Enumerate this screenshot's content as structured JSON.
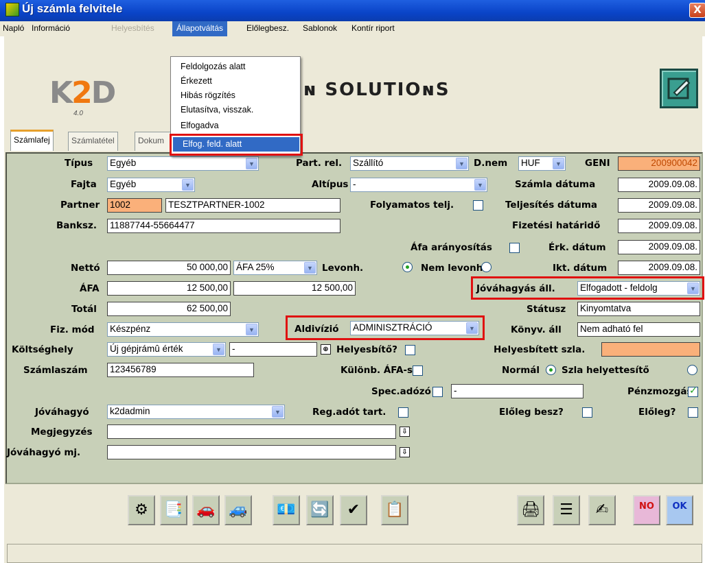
{
  "window": {
    "title": "Új számla felvitele",
    "close_label": "X"
  },
  "menu": [
    "Napló",
    "Információ",
    "Helyesbítés",
    "Állapotváltás",
    "Előlegbesz.",
    "Sablonok",
    "Kontír riport"
  ],
  "dropdown": [
    "Feldolgozás alatt",
    "Érkezett",
    "Hibás rögzítés",
    "Elutasítva, visszak.",
    "Elfogadva",
    "Elfog. feld. alatt"
  ],
  "logo": {
    "k": "K",
    "two": "2",
    "d": "D",
    "version": "4.0",
    "solutions": "ɴ SOLUTIOɴS"
  },
  "tabs": [
    "Számlafej",
    "Számlatétel",
    "Dokum"
  ],
  "labels": {
    "tipus": "Típus",
    "part_rel": "Part. rel.",
    "dnem": "D.nem",
    "geni": "GENI",
    "fajta": "Fajta",
    "altipus": "Altípus",
    "szamla_datuma": "Számla dátuma",
    "partner": "Partner",
    "folyamatos": "Folyamatos telj.",
    "teljesites": "Teljesítés dátuma",
    "banksz": "Banksz.",
    "fizetesi": "Fizetési határidő",
    "afa_aranyositas": "Áfa arányosítás",
    "erk_datum": "Érk. dátum",
    "netto": "Nettó",
    "levonh": "Levonh.",
    "nem_levonh": "Nem levonh.",
    "ikt_datum": "Ikt. dátum",
    "afa": "ÁFA",
    "jovahagyas_all": "Jóváhagyás áll.",
    "total": "Totál",
    "statusz": "Státusz",
    "fiz_mod": "Fiz. mód",
    "aldivizio": "Aldivízió",
    "konyv_all": "Könyv. áll",
    "koltseghely": "Költséghely",
    "helyesbito": "Helyesbítő?",
    "helyesbitett": "Helyesbített szla.",
    "szamlaszam": "Számlaszám",
    "kulonb_afa": "Különb. ÁFA-s",
    "normal": "Normál",
    "szla_helyettesito": "Szla helyettesítő",
    "spec_adozo": "Spec.adózó",
    "penzmozgas": "Pénzmozgás",
    "jovahagyo": "Jóváhagyó",
    "reg_adot": "Reg.adót tart.",
    "eloleg_besz": "Előleg besz?",
    "eloleg": "Előleg?",
    "megjegyzes": "Megjegyzés",
    "jovahagyo_mj": "Jóváhagyó mj."
  },
  "values": {
    "tipus": "Egyéb",
    "part_rel": "Szállító",
    "dnem": "HUF",
    "geni": "200900042",
    "fajta": "Egyéb",
    "altipus": "-",
    "szamla_datuma": "2009.09.08.",
    "partner_code": "1002",
    "partner_name": "TESZTPARTNER-1002",
    "teljesites": "2009.09.08.",
    "banksz": "11887744-55664477",
    "fizetesi": "2009.09.08.",
    "erk_datum": "2009.09.08.",
    "netto": "50 000,00",
    "afa_kulcs": "ÁFA 25%",
    "ikt_datum": "2009.09.08.",
    "afa": "12 500,00",
    "afa2": "12 500,00",
    "jovahagyas_all": "Elfogadott - feldolg",
    "total": "62 500,00",
    "statusz": "Kinyomtatva",
    "fiz_mod": "Készpénz",
    "aldivizio": "ADMINISZTRÁCIÓ",
    "konyv_all": "Nem adható fel",
    "koltseghely": "Új gépjrámû érték",
    "koltseg2": "-",
    "szamlaszam": "123456789",
    "spec_adozo": "-",
    "jovahagyo": "k2dadmin",
    "megjegyzes": "",
    "jovahagyo_mj": ""
  },
  "checks": {
    "folyamatos": false,
    "afa_aranyositas": false,
    "helyesbito": false,
    "kulonb_afa": false,
    "spec_adozo": false,
    "penzmozgas": true,
    "reg_adot": false,
    "eloleg_besz": false,
    "eloleg": false
  },
  "radios": {
    "levonh": true,
    "nem_levonh": false,
    "normal": true,
    "szla_helyettesito": false
  },
  "toolbar": {
    "icons": [
      "gears-icon",
      "documents-icon",
      "car-icon",
      "cars-icon",
      "ado-icon",
      "transfer-icon",
      "approve-check-icon",
      "report-icon",
      "print-icon",
      "list-icon",
      "sign-icon"
    ],
    "no_label": "NO",
    "ok_label": "OK"
  },
  "colors": {
    "title": "#0a44c8",
    "form_bg": "#c8d0b8",
    "highlight": "#e01010",
    "orange_field": "#fab07a",
    "menu_select": "#316ac5"
  }
}
